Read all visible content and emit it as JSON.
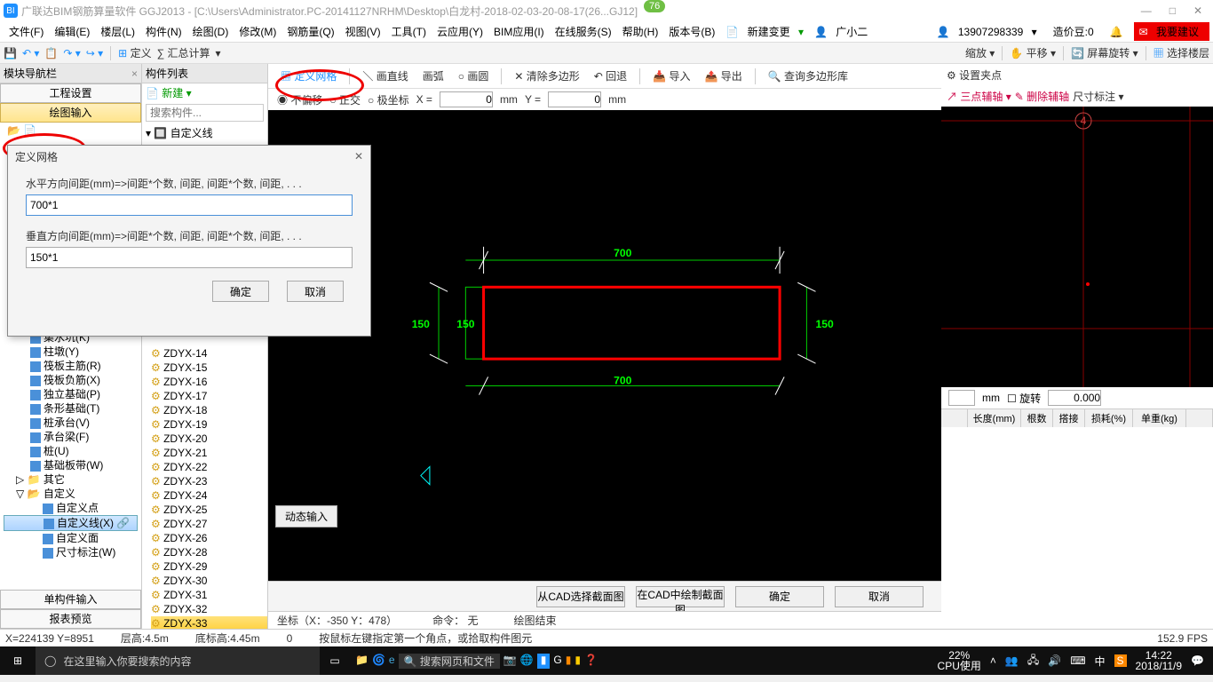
{
  "titlebar": {
    "app_name": "广联达BIM钢筋算量软件 GGJ2013 - ",
    "doc_path": "[C:\\Users\\Administrator.PC-20141127NRHM\\Desktop\\白龙村-2018-02-03-20-08-17(26...GJ12]",
    "badge": "76"
  },
  "menubar": {
    "items": [
      "文件(F)",
      "编辑(E)",
      "楼层(L)",
      "构件(N)",
      "绘图(D)",
      "修改(M)",
      "钢筋量(Q)",
      "视图(V)",
      "工具(T)",
      "云应用(Y)",
      "BIM应用(I)",
      "在线服务(S)",
      "帮助(H)",
      "版本号(B)"
    ],
    "new_change": "新建变更",
    "guangxiaoer": "广小二",
    "phone": "13907298339",
    "cost_bean": "造价豆:0",
    "suggest": "我要建议"
  },
  "toolbar1": {
    "define": "定义",
    "sumcalc": "∑ 汇总计算",
    "zoom": "缩放",
    "pan": "平移",
    "screen_rotate": "屏幕旋转",
    "select_floor": "选择楼层"
  },
  "left": {
    "nav_header": "模块导航栏",
    "proj_setting": "工程设置",
    "draw_input": "绘图输入",
    "tree": [
      {
        "icon": "pit",
        "label": "集水坑(K)"
      },
      {
        "icon": "pier",
        "label": "柱墩(Y)"
      },
      {
        "icon": "raft",
        "label": "筏板主筋(R)"
      },
      {
        "icon": "raftn",
        "label": "筏板负筋(X)"
      },
      {
        "icon": "indep",
        "label": "独立基础(P)"
      },
      {
        "icon": "strip",
        "label": "条形基础(T)"
      },
      {
        "icon": "cap",
        "label": "桩承台(V)"
      },
      {
        "icon": "beam",
        "label": "承台梁(F)"
      },
      {
        "icon": "pile",
        "label": "桩(U)"
      },
      {
        "icon": "band",
        "label": "基础板带(W)"
      }
    ],
    "folders": [
      {
        "label": "其它",
        "open": false
      },
      {
        "label": "自定义",
        "open": true
      }
    ],
    "custom": [
      {
        "label": "自定义点"
      },
      {
        "label": "自定义线(X)",
        "sel": true,
        "link": true
      },
      {
        "label": "自定义面"
      },
      {
        "label": "尺寸标注(W)"
      }
    ],
    "single_comp": "单构件输入",
    "report_preview": "报表预览"
  },
  "mid": {
    "header": "构件列表",
    "new_btn": "新建",
    "search_ph": "搜索构件...",
    "root": "自定义线",
    "items": [
      "ZDYX-14",
      "ZDYX-15",
      "ZDYX-16",
      "ZDYX-17",
      "ZDYX-18",
      "ZDYX-19",
      "ZDYX-20",
      "ZDYX-21",
      "ZDYX-22",
      "ZDYX-23",
      "ZDYX-24",
      "ZDYX-25",
      "ZDYX-27",
      "ZDYX-26",
      "ZDYX-28",
      "ZDYX-29",
      "ZDYX-30",
      "ZDYX-31",
      "ZDYX-32",
      "ZDYX-33"
    ],
    "selected": "ZDYX-33"
  },
  "draw_tb": {
    "define_grid": "定义网格",
    "draw_line": "画直线",
    "draw_arc": "画弧",
    "draw_circle": "画圆",
    "clear_poly": "清除多边形",
    "back": "回退",
    "import": "导入",
    "export": "导出",
    "query_poly": "查询多边形库"
  },
  "coord": {
    "no_offset": "不偏移",
    "ortho": "正交",
    "polar": "极坐标",
    "x_label": "X =",
    "x_val": "0",
    "y_label": "Y =",
    "y_val": "0",
    "unit": "mm"
  },
  "canvas": {
    "dim_top": "700",
    "dim_bottom": "700",
    "dim_left1": "150",
    "dim_left2": "150",
    "dim_right": "150",
    "dyn_input": "动态输入",
    "status": {
      "coord": "坐标（X：-350 Y：478）",
      "cmd": "命令： 无",
      "draw_end": "绘图结束"
    }
  },
  "chart_data": {
    "type": "diagram",
    "shape": "rectangle",
    "width_mm": 700,
    "height_mm": 150,
    "annotations": [
      "700",
      "700",
      "150",
      "150",
      "150"
    ]
  },
  "bottom_btns": {
    "from_cad": "从CAD选择截面图",
    "draw_in_cad": "在CAD中绘制截面图",
    "ok": "确定",
    "cancel": "取消"
  },
  "right": {
    "set_clip": "设置夹点",
    "three_pt": "三点辅轴",
    "del_aux": "删除辅轴",
    "dim_label": "尺寸标注",
    "axis_num": "4",
    "mm": "mm",
    "rotate": "旋转",
    "rotate_val": "0.000",
    "table_headers": [
      "",
      "长度(mm)",
      "根数",
      "搭接",
      "损耗(%)",
      "单重(kg)",
      ""
    ]
  },
  "dialog": {
    "title": "定义网格",
    "h_label": "水平方向间距(mm)=>间距*个数, 间距, 间距*个数, 间距, . . .",
    "h_val": "700*1",
    "v_label": "垂直方向间距(mm)=>间距*个数, 间距, 间距*个数, 间距, . . .",
    "v_val": "150*1",
    "ok": "确定",
    "cancel": "取消"
  },
  "status2": {
    "xy": "X=224139 Y=8951",
    "floor_h": "层高:4.5m",
    "bottom_h": "底标高:4.45m",
    "zero": "0",
    "hint": "按鼠标左键指定第一个角点，或拾取构件图元",
    "fps": "152.9 FPS"
  },
  "taskbar": {
    "search_ph": "在这里输入你要搜索的内容",
    "web_search": "搜索网页和文件",
    "cpu": "22%",
    "cpu_label": "CPU使用",
    "ime": "中",
    "time": "14:22",
    "date": "2018/11/9"
  }
}
